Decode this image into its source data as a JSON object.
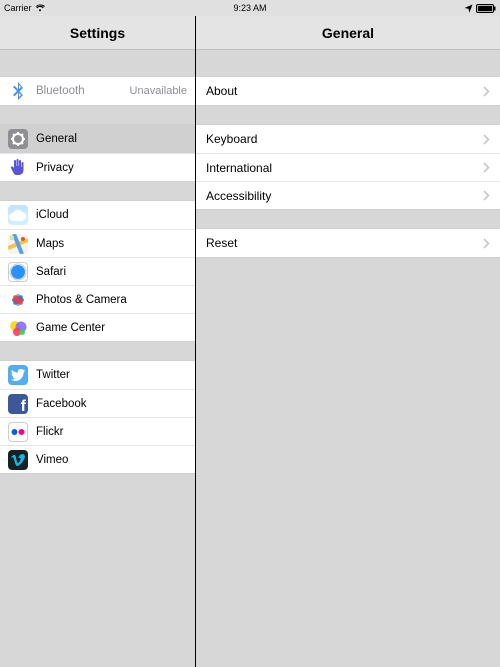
{
  "statusbar": {
    "carrier": "Carrier",
    "time": "9:23 AM"
  },
  "sidebar": {
    "title": "Settings",
    "group0": {
      "bluetooth_label": "Bluetooth",
      "bluetooth_status": "Unavailable"
    },
    "group1": {
      "general_label": "General",
      "privacy_label": "Privacy"
    },
    "group2": {
      "icloud_label": "iCloud",
      "maps_label": "Maps",
      "safari_label": "Safari",
      "photos_label": "Photos & Camera",
      "gamecenter_label": "Game Center"
    },
    "group3": {
      "twitter_label": "Twitter",
      "facebook_label": "Facebook",
      "flickr_label": "Flickr",
      "vimeo_label": "Vimeo"
    }
  },
  "detail": {
    "title": "General",
    "group0": {
      "about_label": "About"
    },
    "group1": {
      "keyboard_label": "Keyboard",
      "international_label": "International",
      "accessibility_label": "Accessibility"
    },
    "group2": {
      "reset_label": "Reset"
    }
  }
}
